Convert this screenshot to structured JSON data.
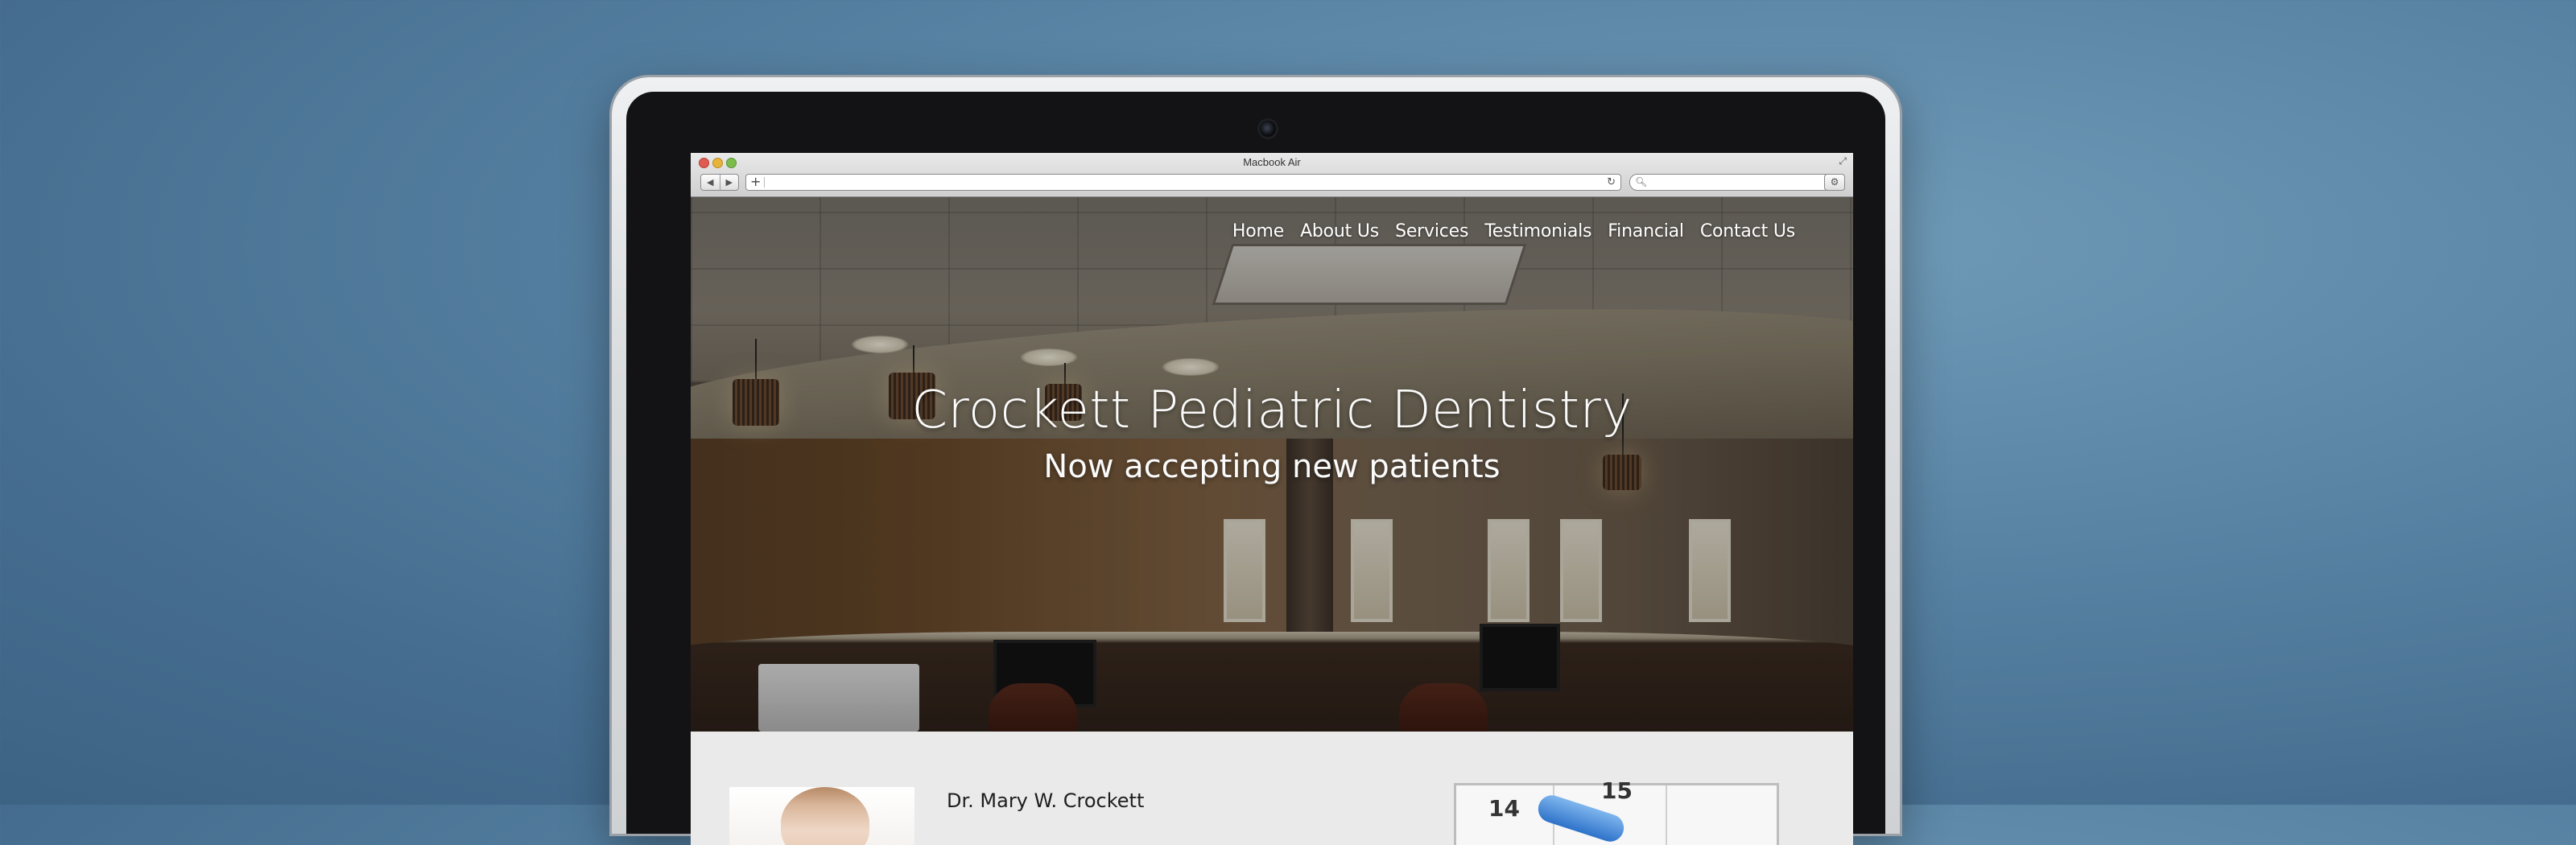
{
  "browser": {
    "window_title": "Macbook Air",
    "back_label": "◀",
    "forward_label": "▶",
    "new_tab_label": "+",
    "reload_label": "↻",
    "search_icon_label": "🔍︎",
    "action_label": "⚙"
  },
  "site": {
    "nav": [
      "Home",
      "About Us",
      "Services",
      "Testimonials",
      "Financial",
      "Contact Us"
    ],
    "hero_title": "Crockett Pediatric Dentistry",
    "hero_subtitle": "Now accepting new patients",
    "doctor_name": "Dr. Mary W. Crockett",
    "calendar_numbers": [
      "14",
      "15"
    ]
  },
  "colors": {
    "background": "#5b86a6",
    "nav_text": "#ffffff",
    "content_bg": "#ebeaea"
  }
}
